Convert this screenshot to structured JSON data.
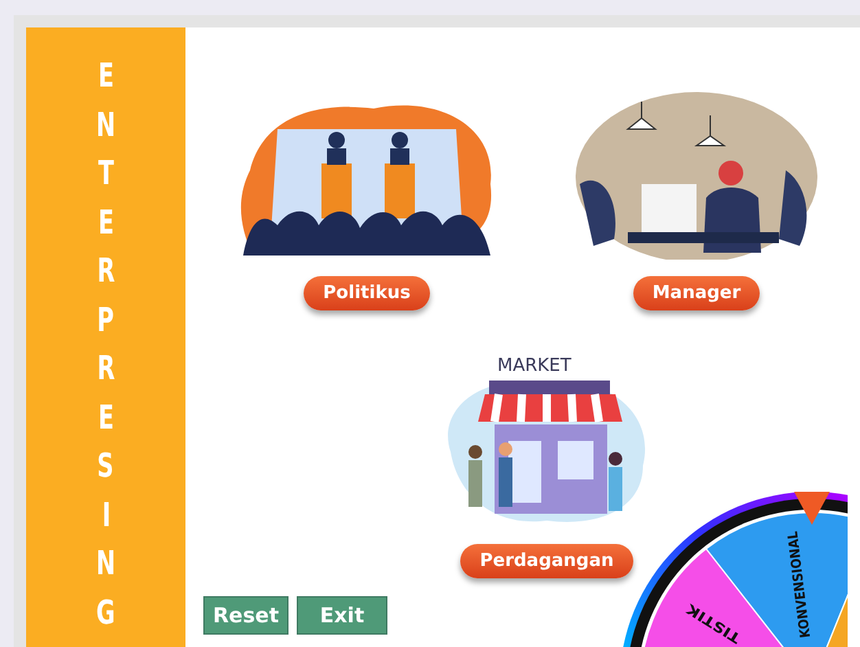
{
  "sidebar": {
    "letters": [
      "E",
      "N",
      "T",
      "E",
      "R",
      "P",
      "R",
      "E",
      "S",
      "I",
      "N",
      "G"
    ]
  },
  "cards": [
    {
      "kind": "debate",
      "label": "Politikus"
    },
    {
      "kind": "office",
      "label": "Manager"
    },
    {
      "kind": "market",
      "label": "Perdagangan",
      "sign": "MARKET"
    }
  ],
  "buttons": [
    "Reset",
    "Exit"
  ],
  "wheel": {
    "segments": [
      {
        "label": "TISTIK",
        "color": "#f54ee8"
      },
      {
        "label": "KONVENSIONAL",
        "color": "#2d9bf0"
      },
      {
        "color": "#f5a623"
      }
    ]
  }
}
